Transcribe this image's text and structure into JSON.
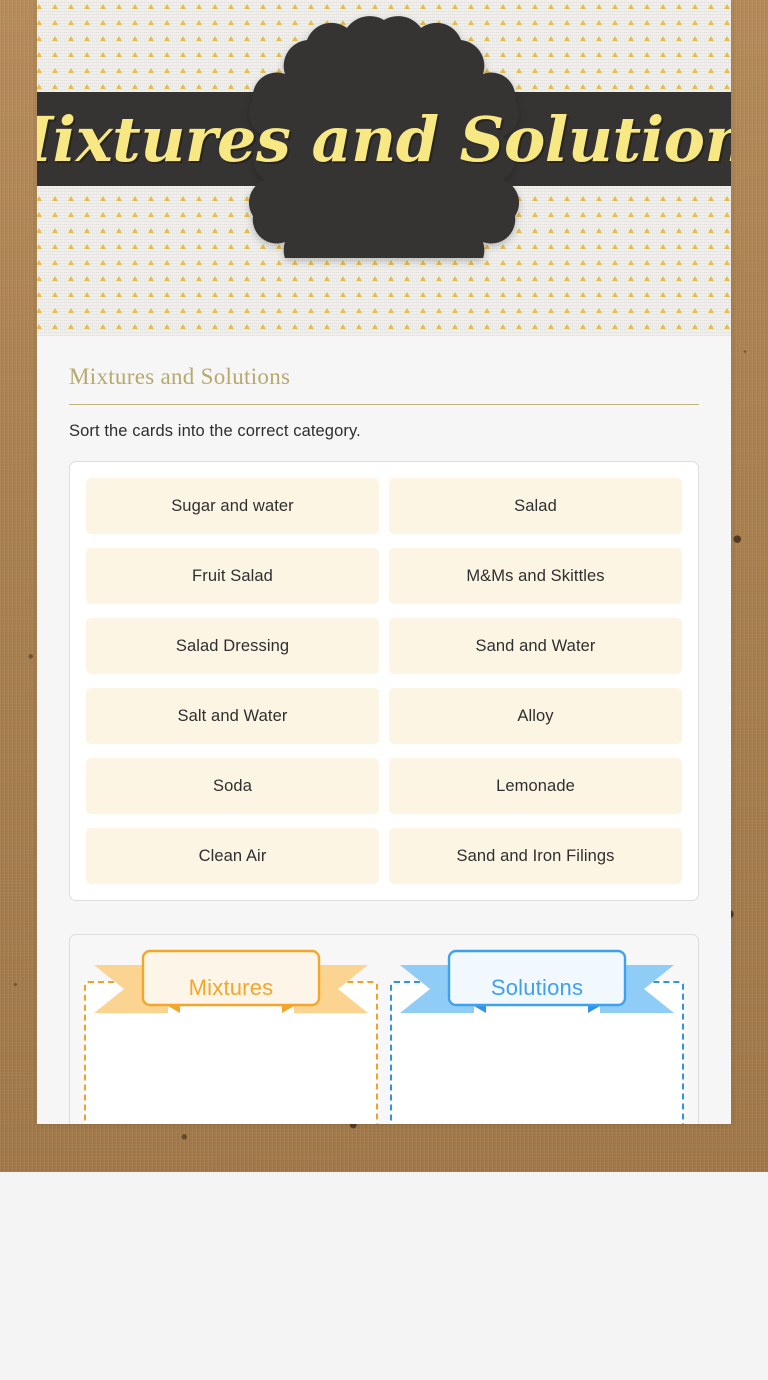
{
  "header": {
    "title": "Mixtures and Solutions",
    "badge_icon": "ornate-scalloped-badge"
  },
  "worksheet": {
    "subtitle": "Mixtures and Solutions",
    "instructions": "Sort the cards into the correct category."
  },
  "cards": [
    {
      "label": "Sugar and water"
    },
    {
      "label": "Salad"
    },
    {
      "label": "Fruit Salad"
    },
    {
      "label": "M&Ms and Skittles"
    },
    {
      "label": "Salad Dressing"
    },
    {
      "label": "Sand and Water"
    },
    {
      "label": "Salt and Water"
    },
    {
      "label": "Alloy"
    },
    {
      "label": "Soda"
    },
    {
      "label": "Lemonade"
    },
    {
      "label": "Clean Air"
    },
    {
      "label": "Sand and Iron Filings"
    }
  ],
  "zones": [
    {
      "label": "Mixtures",
      "accent": "#f4a62a",
      "tail": "#fbd491",
      "fill": "#fdf6e8"
    },
    {
      "label": "Solutions",
      "accent": "#3fa0f0",
      "tail": "#8fcdf7",
      "fill": "#f1f8fe"
    }
  ],
  "colors": {
    "kraft": "#a9804f",
    "dark_band": "#363433",
    "title_yellow": "#f7e883",
    "subtitle_olive": "#b6a96c",
    "card_cream": "#fdf5e3",
    "pattern_gold": "#e3bd42"
  }
}
